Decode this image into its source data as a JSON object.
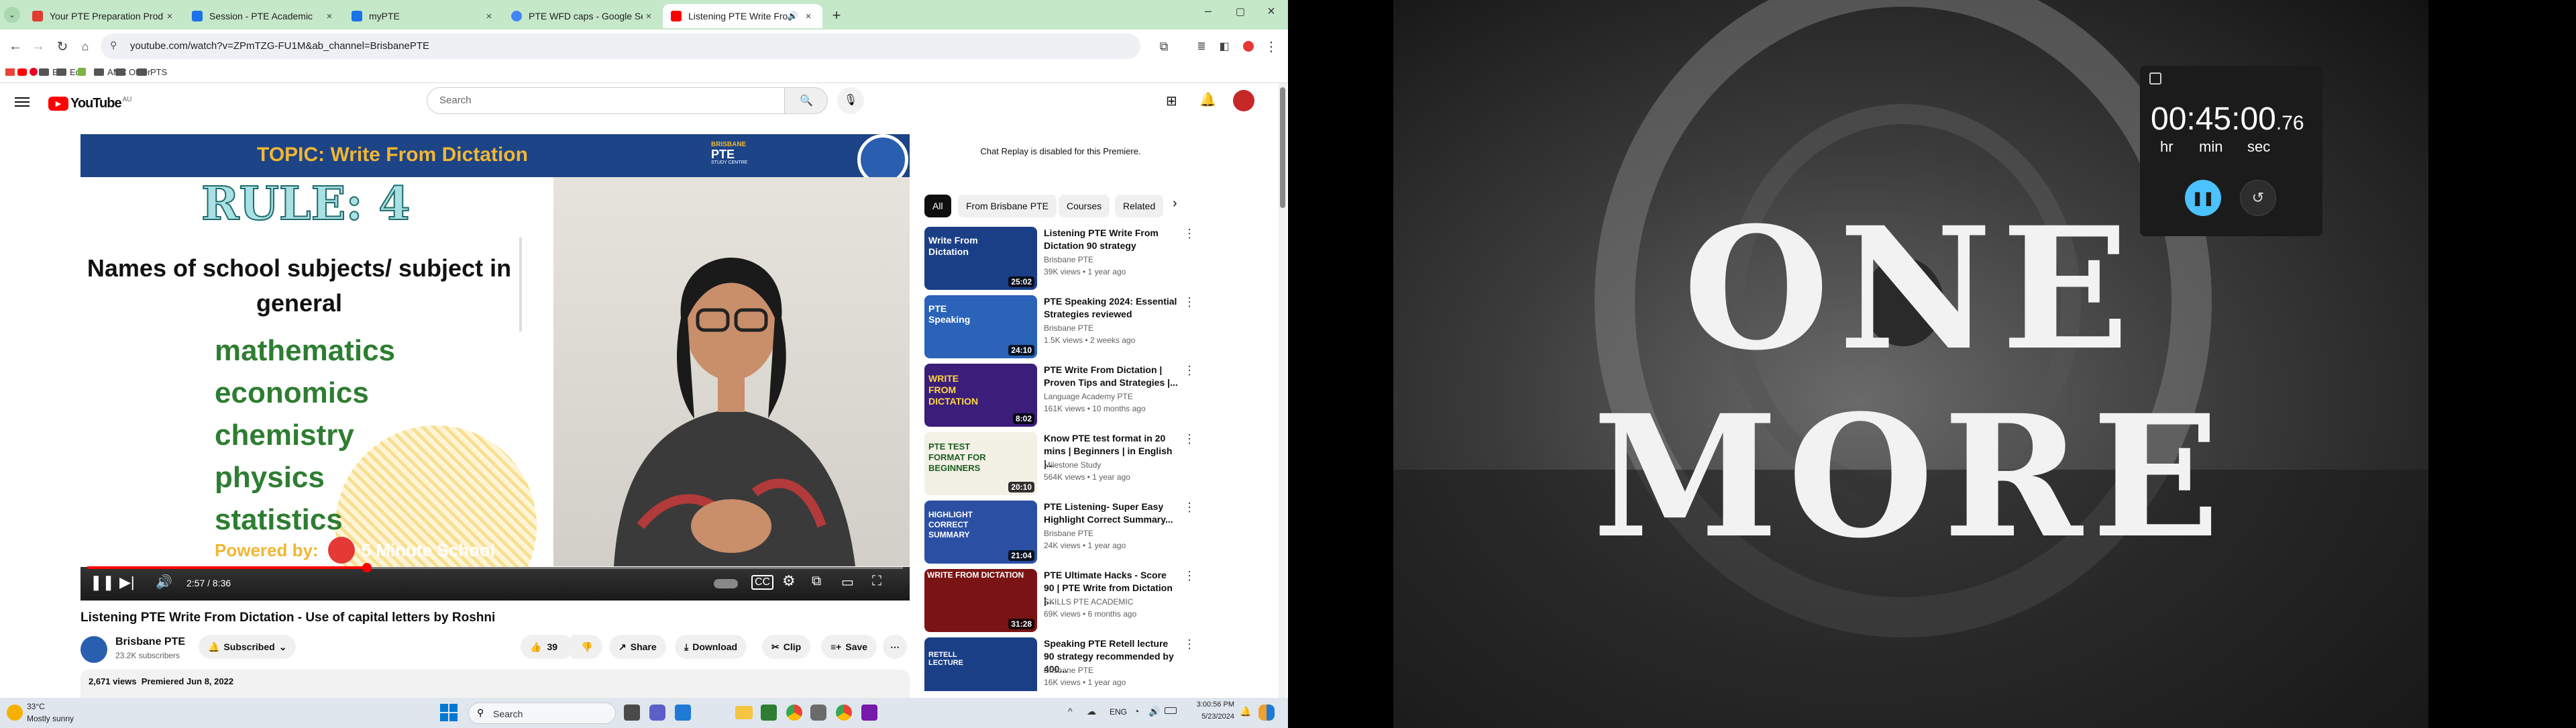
{
  "browser": {
    "tabs": [
      {
        "title": "Your PTE Preparation Product",
        "favicon_color": "#e03c31"
      },
      {
        "title": "Session - PTE Academic",
        "favicon_color": "#1a73e8"
      },
      {
        "title": "myPTE",
        "favicon_color": "#1a73e8"
      },
      {
        "title": "PTE WFD caps - Google Search",
        "favicon_color": "#4285f4"
      },
      {
        "title": "Listening PTE Write From D",
        "favicon_color": "#ff0000",
        "active": true
      }
    ],
    "url": "youtube.com/watch?v=ZPmTZG-FU1M&ab_channel=BrisbanePTE",
    "bookmarks": [
      "Ent",
      "Edu",
      "AMC",
      "Other",
      "PTS"
    ]
  },
  "youtube": {
    "logo_text": "YouTube",
    "region": "AU",
    "search_placeholder": "Search",
    "video": {
      "banner_title": "TOPIC: Write From Dictation",
      "brand_line1": "BRISBANE",
      "brand_line2": "PTE",
      "brand_line3": "STUDY CENTRE",
      "rule": "RULE: 4",
      "heading": "Names of school subjects/ subject in general",
      "subjects": [
        "mathematics",
        "economics",
        "chemistry",
        "physics",
        "statistics"
      ],
      "powered_by": "Powered by:",
      "powered_name": "5 Minute School",
      "time": "2:57 / 8:36",
      "progress": 0.343
    },
    "title": "Listening PTE Write From Dictation - Use of capital letters by Roshni",
    "channel": {
      "name": "Brisbane PTE",
      "subscribers": "23.2K subscribers",
      "subscribed_label": "Subscribed"
    },
    "actions": {
      "likes": "39",
      "share": "Share",
      "download": "Download",
      "clip": "Clip",
      "save": "Save"
    },
    "description_meta": "2,671 views  Premiered Jun 8, 2022",
    "chat_notice": "Chat Replay is disabled for this Premiere.",
    "chips": [
      "All",
      "From Brisbane PTE",
      "Courses",
      "Related"
    ],
    "recommendations": [
      {
        "title": "Listening PTE Write From Dictation 90 strategy",
        "channel": "Brisbane PTE",
        "meta": "39K views • 1 year ago",
        "duration": "25:02",
        "thumb_color": "#1a3f86",
        "thumb_text": "Write From Dictation"
      },
      {
        "title": "PTE Speaking 2024: Essential Strategies reviewed",
        "channel": "Brisbane PTE",
        "meta": "1.5K views • 2 weeks ago",
        "duration": "24:10",
        "thumb_color": "#2a63b8",
        "thumb_text": "PTE Speaking"
      },
      {
        "title": "PTE Write From Dictation | Proven Tips and Strategies |...",
        "channel": "Language Academy PTE",
        "meta": "161K views • 10 months ago",
        "duration": "8:02",
        "thumb_color": "#3b1d7a",
        "thumb_text": "WRITE FROM DICTATION"
      },
      {
        "title": "Know PTE test format in 20 mins | Beginners | in English |...",
        "channel": "Milestone Study",
        "meta": "564K views • 1 year ago",
        "duration": "20:10",
        "thumb_color": "#f3f0e6",
        "thumb_text": "PTE TEST FORMAT FOR BEGINNERS"
      },
      {
        "title": "PTE Listening- Super Easy Highlight Correct Summary...",
        "channel": "Brisbane PTE",
        "meta": "24K views • 1 year ago",
        "duration": "21:04",
        "thumb_color": "#2b4fa3",
        "thumb_text": "HIGHLIGHT CORRECT SUMMARY"
      },
      {
        "title": "PTE Ultimate Hacks - Score 90 | PTE Write from Dictation |...",
        "channel": "SKILLS PTE ACADEMIC",
        "meta": "69K views • 6 months ago",
        "duration": "31:28",
        "thumb_color": "#7a1414",
        "thumb_text": "WRITE FROM DICTATION"
      },
      {
        "title": "Speaking PTE Retell lecture 90 strategy recommended by 400...",
        "channel": "Brisbane PTE",
        "meta": "16K views • 1 year ago",
        "duration": "",
        "thumb_color": "#1a3f86",
        "thumb_text": "RETELL LECTURE"
      }
    ]
  },
  "timer": {
    "hours": "00",
    "minutes": "45",
    "seconds": "00",
    "centis": ".76",
    "hr_label": "hr",
    "min_label": "min",
    "sec_label": "sec"
  },
  "wallpaper_text": "ONE MORE",
  "taskbar": {
    "weather_temp": "33°C",
    "weather_desc": "Mostly sunny",
    "search_placeholder": "Search",
    "lang": "ENG",
    "time": "3:00:56 PM",
    "date": "5/23/2024"
  }
}
